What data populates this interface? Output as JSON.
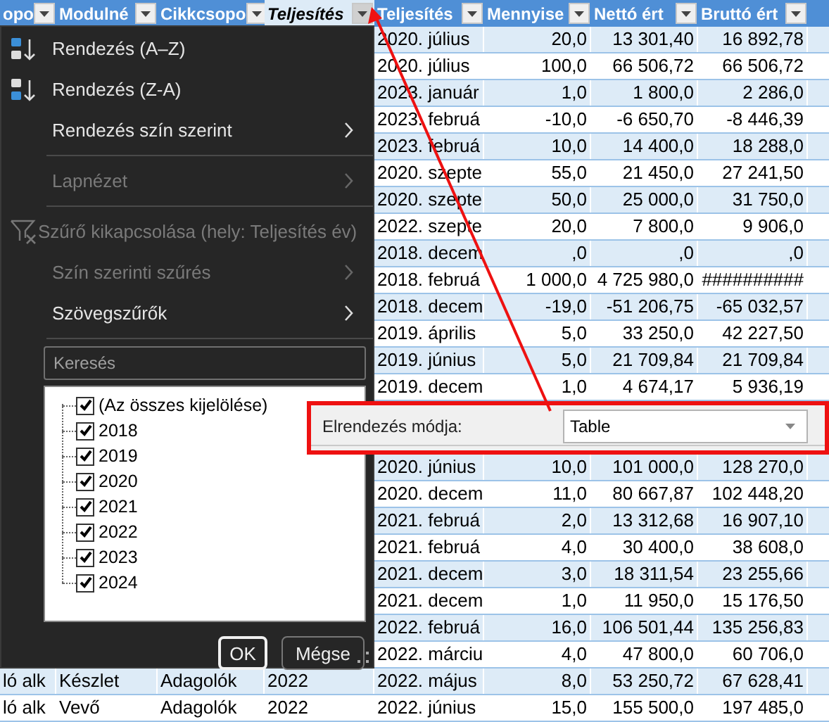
{
  "table": {
    "columns": [
      {
        "label": "opo",
        "selected": false
      },
      {
        "label": "Modulné",
        "selected": false
      },
      {
        "label": "Cikkcsopo",
        "selected": false
      },
      {
        "label": "Teljesítés",
        "selected": true
      },
      {
        "label": "Teljesítés",
        "selected": false
      },
      {
        "label": "Mennyise",
        "selected": false
      },
      {
        "label": "Nettó ért",
        "selected": false
      },
      {
        "label": "Bruttó ért",
        "selected": false
      }
    ],
    "row_groups": [
      [
        {
          "cells": [
            "2020. július",
            "20,0",
            "13 301,40",
            "16 892,78"
          ]
        },
        {
          "cells": [
            "2020. július",
            "100,0",
            "66 506,72",
            "66 506,72"
          ]
        },
        {
          "cells": [
            "2023. január",
            "1,0",
            "1 800,0",
            "2 286,0"
          ]
        },
        {
          "cells": [
            "2023. februá",
            "-10,0",
            "-6 650,70",
            "-8 446,39"
          ]
        },
        {
          "cells": [
            "2023. februá",
            "10,0",
            "14 400,0",
            "18 288,0"
          ]
        },
        {
          "cells": [
            "2020. szepte",
            "55,0",
            "21 450,0",
            "27 241,50"
          ]
        },
        {
          "cells": [
            "2020. szepte",
            "50,0",
            "25 000,0",
            "31 750,0"
          ]
        },
        {
          "cells": [
            "2022. szepte",
            "20,0",
            "7 800,0",
            "9 906,0"
          ]
        },
        {
          "cells": [
            "2018. decem",
            ",0",
            ",0",
            ",0"
          ]
        },
        {
          "cells": [
            "2018. februá",
            "1 000,0",
            "4 725 980,0",
            "##########"
          ]
        },
        {
          "cells": [
            "2018. decem",
            "-19,0",
            "-51 206,75",
            "-65 032,57"
          ]
        },
        {
          "cells": [
            "2019. április",
            "5,0",
            "33 250,0",
            "42 227,50"
          ]
        },
        {
          "cells": [
            "2019. június",
            "5,0",
            "21 709,84",
            "21 709,84"
          ]
        },
        {
          "cells": [
            "2019. decem",
            "1,0",
            "4 674,17",
            "5 936,19"
          ]
        }
      ],
      [
        {
          "cells": [
            "2020. június",
            "10,0",
            "101 000,0",
            "128 270,0"
          ]
        },
        {
          "cells": [
            "2020. decem",
            "11,0",
            "80 667,87",
            "102 448,20"
          ]
        },
        {
          "cells": [
            "2021. februá",
            "2,0",
            "13 312,68",
            "16 907,10"
          ]
        },
        {
          "cells": [
            "2021. februá",
            "4,0",
            "30 400,0",
            "38 608,0"
          ]
        },
        {
          "cells": [
            "2021. decem",
            "3,0",
            "18 311,54",
            "23 255,66"
          ]
        },
        {
          "cells": [
            "2021. decem",
            "1,0",
            "11 950,0",
            "15 176,50"
          ]
        },
        {
          "cells": [
            "2022. februá",
            "16,0",
            "106 501,44",
            "135 256,83"
          ]
        },
        {
          "cells": [
            "2022. márciu",
            "4,0",
            "47 800,0",
            "60 706,0"
          ]
        },
        {
          "cells": [
            "ló alk",
            "Készlet",
            "Adagolók",
            "2022",
            "2022. május",
            "8,0",
            "53 250,72",
            "67 628,41"
          ]
        },
        {
          "cells": [
            "ló alk",
            "Vevő",
            "Adagolók",
            "2022",
            "2022. június",
            "15,0",
            "155 500,0",
            "197 485,0"
          ]
        }
      ]
    ]
  },
  "layout_panel": {
    "label": "Elrendezés módja:",
    "value": "Table"
  },
  "filter_menu": {
    "items": [
      {
        "kind": "sort-asc",
        "label": "Rendezés (A–Z)",
        "disabled": false,
        "submenu": false
      },
      {
        "kind": "sort-desc",
        "label": "Rendezés (Z-A)",
        "disabled": false,
        "submenu": false
      },
      {
        "kind": "item",
        "label": "Rendezés szín szerint",
        "disabled": false,
        "submenu": true
      },
      {
        "kind": "separator"
      },
      {
        "kind": "item",
        "label": "Lapnézet",
        "disabled": true,
        "submenu": true
      },
      {
        "kind": "separator"
      },
      {
        "kind": "clear-filter",
        "label": "Szűrő kikapcsolása (hely: Teljesítés év)",
        "disabled": true,
        "submenu": false
      },
      {
        "kind": "item",
        "label": "Szín szerinti szűrés",
        "disabled": true,
        "submenu": true
      },
      {
        "kind": "item",
        "label": "Szövegszűrők",
        "disabled": false,
        "submenu": true
      },
      {
        "kind": "separator"
      }
    ],
    "search": {
      "placeholder": "Keresés"
    },
    "values": [
      {
        "label": "(Az összes kijelölése)",
        "checked": true
      },
      {
        "label": "2018",
        "checked": true
      },
      {
        "label": "2019",
        "checked": true
      },
      {
        "label": "2020",
        "checked": true
      },
      {
        "label": "2021",
        "checked": true
      },
      {
        "label": "2022",
        "checked": true
      },
      {
        "label": "2023",
        "checked": true
      },
      {
        "label": "2024",
        "checked": true
      }
    ],
    "buttons": [
      {
        "label": "OK",
        "default": true
      },
      {
        "label": "Mégse",
        "default": false
      }
    ]
  }
}
